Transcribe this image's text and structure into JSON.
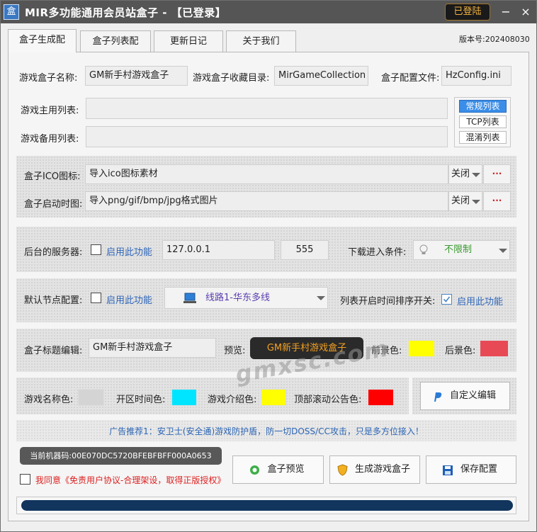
{
  "window": {
    "app_icon_glyph": "盒",
    "title": "MIR多功能通用会员站盒子 - 【已登录】",
    "login_button": "已登陆",
    "minimize_glyph": "−",
    "close_glyph": "×"
  },
  "tabs": [
    {
      "label": "盒子生成配"
    },
    {
      "label": "盒子列表配"
    },
    {
      "label": "更新日记"
    },
    {
      "label": "关于我们"
    }
  ],
  "version": "版本号:202408030",
  "config": {
    "box_name_label": "游戏盒子名称:",
    "box_name_value": "GM新手村游戏盒子",
    "collection_dir_label": "游戏盒子收藏目录:",
    "collection_dir_value": "MirGameCollection",
    "config_file_label": "盒子配置文件:",
    "config_file_value": "HzConfig.ini",
    "main_list_label": "游戏主用列表:",
    "backup_list_label": "游戏备用列表:",
    "list_types": [
      "常规列表",
      "TCP列表",
      "混淆列表"
    ]
  },
  "icons": {
    "ico_label": "盒子ICO图标:",
    "ico_value": "导入ico图标素材",
    "ico_toggle": "关闭",
    "splash_label": "盒子启动时图:",
    "splash_value": "导入png/gif/bmp/jpg格式图片",
    "splash_toggle": "关闭",
    "browse_glyph": "···"
  },
  "server": {
    "label": "后台的服务器:",
    "enable_label": "启用此功能",
    "ip": "127.0.0.1",
    "port": "555",
    "download_label": "下载进入条件:",
    "download_value": "不限制"
  },
  "node": {
    "label": "默认节点配置:",
    "enable_label": "启用此功能",
    "line_value": "线路1-华东多线",
    "sort_label": "列表开启时间排序开关:",
    "sort_enable_label": "启用此功能"
  },
  "title_edit": {
    "label": "盒子标题编辑:",
    "value": "GM新手村游戏盒子",
    "preview_label": "预览:",
    "preview_text": "GM新手村游戏盒子",
    "fg_label": "前景色:",
    "bg_label": "后景色:",
    "fg_color": "#ffff00",
    "bg_color": "#e84a55"
  },
  "colors": {
    "name_label": "游戏名称色:",
    "opentime_label": "开区时间色:",
    "intro_label": "游戏介绍色:",
    "scroll_label": "顶部滚动公告色:",
    "name_color": "#d4d4d4",
    "opentime_color": "#00e5ff",
    "intro_color": "#ffff00",
    "scroll_color": "#ff0000",
    "custom_edit_button": "自定义编辑"
  },
  "ad": "广告推荐1：安卫士(安全通)游戏防护盾，防一切DOSS/CC攻击，只是多方位接入！",
  "machine_code": "当前机器码:00E070DC5720BFEBFBFF000A0653",
  "agreement": "我同意《免责用户协议-合理架设，取得正版授权》",
  "actions": {
    "preview": "盒子预览",
    "generate": "生成游戏盒子",
    "save": "保存配置"
  },
  "watermark": "gmxsc.com",
  "progress": 1.0
}
